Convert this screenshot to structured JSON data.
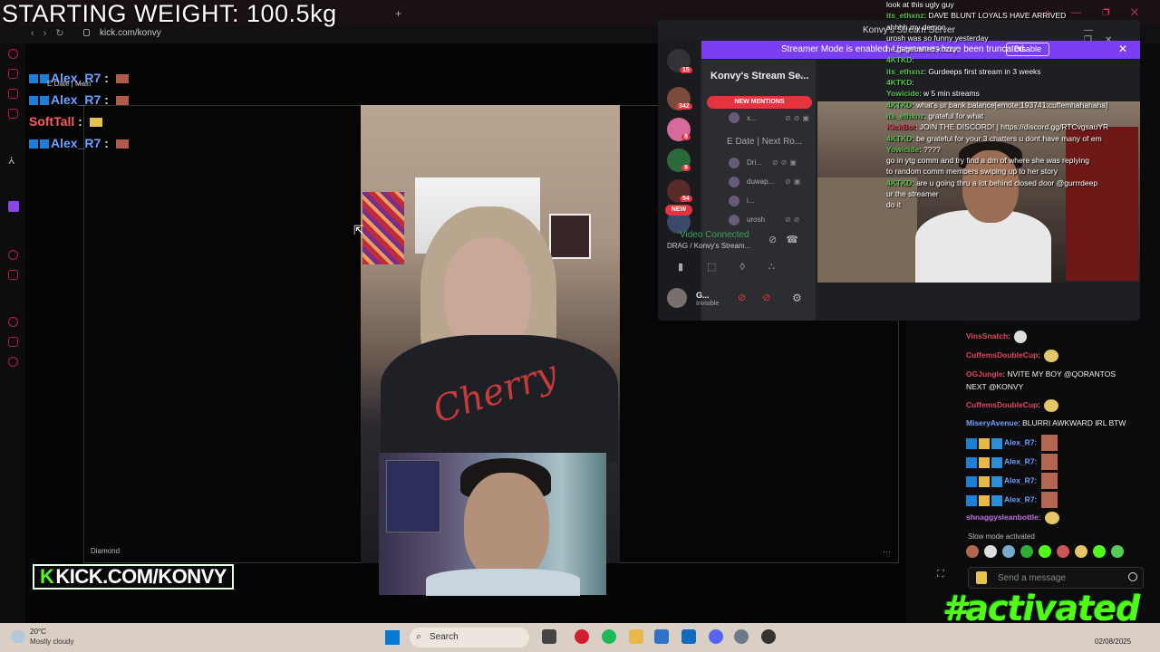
{
  "overlay": {
    "weight_text": "STARTING WEIGHT: 100.5kg",
    "kick_brand": "KICK.COM/KONVY",
    "hashtag": "#activated",
    "diamond_label": "Diamond"
  },
  "browser": {
    "url": "kick.com/konvy"
  },
  "left_chat": [
    {
      "name": "Alex_R7",
      "color": "blue"
    },
    {
      "name": "Alex_R7",
      "color": "blue"
    },
    {
      "name": "SoftTall",
      "color": "red"
    },
    {
      "name": "Alex_R7",
      "color": "blue"
    }
  ],
  "left_chat_sub": "E Date | Main",
  "discord": {
    "window_title": "Konvy's Stream Server",
    "banner_text": "Streamer Mode is enabled. Usernames have been truncated.",
    "disable_label": "Disable",
    "server_name": "Konvy's Stream Se...",
    "new_mentions": "NEW MENTIONS",
    "new_label": "NEW",
    "server_badges": [
      "15",
      "342",
      "8",
      "9",
      "54"
    ],
    "channel_name": "E Date | Next Ro...",
    "users": [
      "x...",
      "Dri...",
      "duwap...",
      "i...",
      "urosh"
    ],
    "voice_status": "Video Connected",
    "voice_channel": "DRAG / Konvy's Stream...",
    "me_name": "G...",
    "me_status": "Invisible"
  },
  "overlay_chat": [
    {
      "user": "",
      "text": "look at this ugly guy",
      "color": "red"
    },
    {
      "user": "its_ethxnz",
      "text": "DAVE BLUNT LOYALS HAVE ARRIVED",
      "color": "green"
    },
    {
      "user": "",
      "text": "ahhhh my demon",
      "color": "red"
    },
    {
      "user": "",
      "text": "urosh was so funny yesterday",
      "color": "red"
    },
    {
      "user": "",
      "text": "he gagebaited kozzy",
      "color": "red"
    },
    {
      "user": "4KTKD",
      "text": "",
      "color": "green"
    },
    {
      "user": "its_ethxnz",
      "text": "Gurdeeps first stream in 3 weeks",
      "color": "green"
    },
    {
      "user": "4KTKD",
      "text": "",
      "color": "green"
    },
    {
      "user": "Yowicide",
      "text": "w 5 min streams",
      "color": "green"
    },
    {
      "user": "4KTKD",
      "text": "what's ur bank balance[emote:193741:cuffemhahahaha]",
      "color": "green"
    },
    {
      "user": "its_ethxnz",
      "text": "grateful for what",
      "color": "green"
    },
    {
      "user": "KickBot",
      "text": "JOIN THE DISCORD! | https://discord.gg/RTCvgsauYR",
      "color": "red"
    },
    {
      "user": "4KTKD",
      "text": "be grateful for your 3 chatters u dont have many of em",
      "color": "green"
    },
    {
      "user": "Yowicide",
      "text": "????",
      "color": "green"
    },
    {
      "user": "",
      "text": "go in ytg comm and try find a dm of where she was replying",
      "color": "red"
    },
    {
      "user": "",
      "text": "to random comm members swiping up to her story",
      "color": ""
    },
    {
      "user": "4KTKD",
      "text": "are u going thru a lot behind closed door @gurrrdeep",
      "color": "green"
    },
    {
      "user": "",
      "text": "ur the streamer",
      "color": "red"
    },
    {
      "user": "",
      "text": "do it",
      "color": "red"
    }
  ],
  "right_chat": [
    {
      "user": "VinsSnatch",
      "text": "",
      "color": "#e0455a",
      "emote": "skull"
    },
    {
      "user": "CuffemsDoubleCup",
      "text": "",
      "color": "#e0455a",
      "emote": "face"
    },
    {
      "user": "OGJungle",
      "text": "NVITE MY BOY @QORANTOS",
      "text2": "NEXT @KONVY",
      "color": "#e0455a"
    },
    {
      "user": "CuffemsDoubleCup",
      "text": "",
      "color": "#e0455a",
      "emote": "face"
    },
    {
      "user": "MiseryAvenue",
      "text": "BLURRI AWKWARD IRL BTW",
      "color": "#6fa0ff"
    },
    {
      "user": "Alex_R7",
      "text": "",
      "color": "#6fa0ff"
    },
    {
      "user": "Alex_R7",
      "text": "",
      "color": "#6fa0ff"
    },
    {
      "user": "Alex_R7",
      "text": "",
      "color": "#6fa0ff"
    },
    {
      "user": "Alex_R7",
      "text": "",
      "color": "#6fa0ff"
    },
    {
      "user": "shnaggysleanbottle",
      "text": "",
      "color": "#c06fe0"
    }
  ],
  "slow_mode": "Slow mode activated",
  "send_placeholder": "Send a message",
  "taskbar": {
    "temperature": "20°C",
    "condition": "Mostly cloudy",
    "search_label": "Search",
    "date": "02/08/2025"
  },
  "colors": {
    "kick_green": "#53fc18",
    "discord_purple": "#7b3ff2",
    "alert_red": "#e5333f"
  }
}
